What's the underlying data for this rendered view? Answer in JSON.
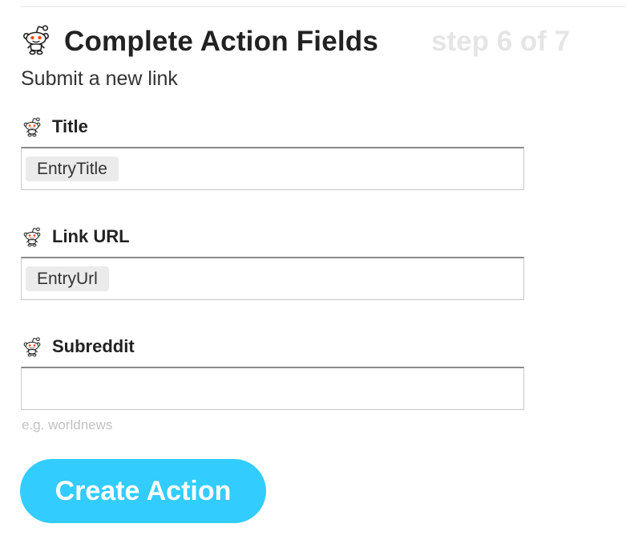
{
  "header": {
    "title": "Complete Action Fields",
    "step": "step 6 of 7",
    "service_icon": "reddit-alien-icon"
  },
  "subtitle": "Submit a new link",
  "fields": [
    {
      "label": "Title",
      "value": "EntryTitle",
      "icon": "reddit-alien-icon"
    },
    {
      "label": "Link URL",
      "value": "EntryUrl",
      "icon": "reddit-alien-icon"
    },
    {
      "label": "Subreddit",
      "value": "",
      "placeholder": "",
      "helper": "e.g. worldnews",
      "icon": "reddit-alien-icon"
    }
  ],
  "actions": {
    "create_label": "Create Action"
  },
  "colors": {
    "accent": "#33ccff",
    "step_text": "#e5e5e5",
    "token_bg": "#ebebeb",
    "helper_text": "#c2c2c2"
  }
}
